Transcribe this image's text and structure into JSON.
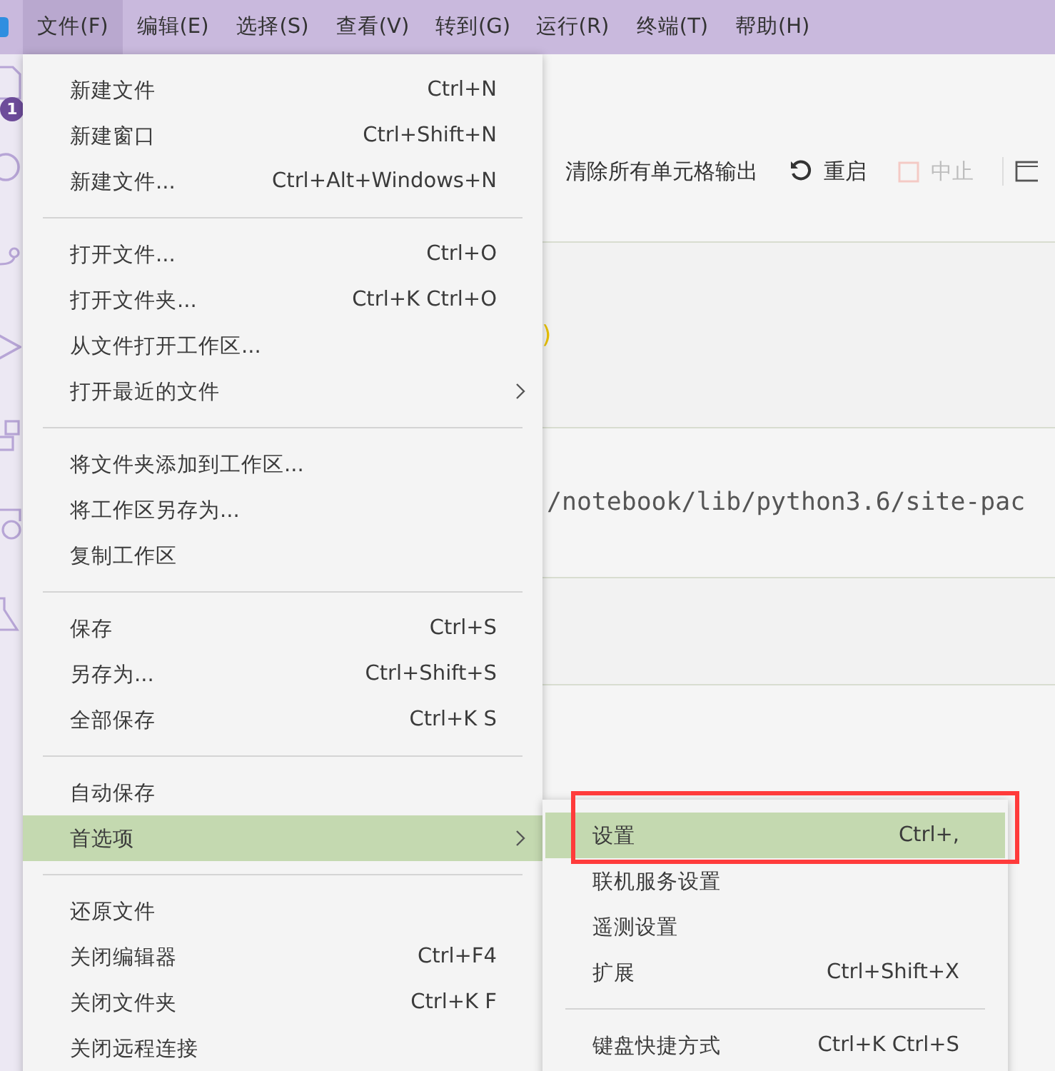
{
  "menubar": {
    "items": [
      {
        "label": "文件(F)",
        "selected": true
      },
      {
        "label": "编辑(E)",
        "selected": false
      },
      {
        "label": "选择(S)",
        "selected": false
      },
      {
        "label": "查看(V)",
        "selected": false
      },
      {
        "label": "转到(G)",
        "selected": false
      },
      {
        "label": "运行(R)",
        "selected": false
      },
      {
        "label": "终端(T)",
        "selected": false
      },
      {
        "label": "帮助(H)",
        "selected": false
      }
    ]
  },
  "activity_bar": {
    "badge": "1"
  },
  "toolbar": {
    "items": [
      {
        "kind": "clear",
        "label": "清除所有单元格输出",
        "disabled": false
      },
      {
        "kind": "restart",
        "label": "重启",
        "disabled": false
      },
      {
        "kind": "stop",
        "label": "中止",
        "disabled": true
      },
      {
        "kind": "variables"
      }
    ]
  },
  "editor": {
    "code_fragment": ")",
    "output_text": "/notebook/lib/python3.6/site-pac"
  },
  "file_menu": {
    "groups": [
      [
        {
          "label": "新建文件",
          "shortcut": "Ctrl+N",
          "submenu": false,
          "selected": false
        },
        {
          "label": "新建窗口",
          "shortcut": "Ctrl+Shift+N",
          "submenu": false,
          "selected": false
        },
        {
          "label": "新建文件...",
          "shortcut": "Ctrl+Alt+Windows+N",
          "submenu": false,
          "selected": false
        }
      ],
      [
        {
          "label": "打开文件...",
          "shortcut": "Ctrl+O",
          "submenu": false,
          "selected": false
        },
        {
          "label": "打开文件夹...",
          "shortcut": "Ctrl+K Ctrl+O",
          "submenu": false,
          "selected": false
        },
        {
          "label": "从文件打开工作区...",
          "submenu": false,
          "selected": false
        },
        {
          "label": "打开最近的文件",
          "submenu": true,
          "selected": false
        }
      ],
      [
        {
          "label": "将文件夹添加到工作区...",
          "submenu": false,
          "selected": false
        },
        {
          "label": "将工作区另存为...",
          "submenu": false,
          "selected": false
        },
        {
          "label": "复制工作区",
          "submenu": false,
          "selected": false
        }
      ],
      [
        {
          "label": "保存",
          "shortcut": "Ctrl+S",
          "submenu": false,
          "selected": false
        },
        {
          "label": "另存为...",
          "shortcut": "Ctrl+Shift+S",
          "submenu": false,
          "selected": false
        },
        {
          "label": "全部保存",
          "shortcut": "Ctrl+K S",
          "submenu": false,
          "selected": false
        }
      ],
      [
        {
          "label": "自动保存",
          "submenu": false,
          "selected": false
        },
        {
          "label": "首选项",
          "submenu": true,
          "selected": true
        }
      ],
      [
        {
          "label": "还原文件",
          "submenu": false,
          "selected": false
        },
        {
          "label": "关闭编辑器",
          "shortcut": "Ctrl+F4",
          "submenu": false,
          "selected": false
        },
        {
          "label": "关闭文件夹",
          "shortcut": "Ctrl+K F",
          "submenu": false,
          "selected": false
        },
        {
          "label": "关闭远程连接",
          "submenu": false,
          "selected": false
        }
      ]
    ]
  },
  "preferences_submenu": {
    "highlight_frame": true,
    "groups": [
      [
        {
          "label": "设置",
          "shortcut": "Ctrl+,",
          "submenu": false,
          "selected": true
        },
        {
          "label": "联机服务设置",
          "submenu": false,
          "selected": false
        },
        {
          "label": "遥测设置",
          "submenu": false,
          "selected": false
        },
        {
          "label": "扩展",
          "shortcut": "Ctrl+Shift+X",
          "submenu": false,
          "selected": false
        }
      ],
      [
        {
          "label": "键盘快捷方式",
          "shortcut": "Ctrl+K Ctrl+S",
          "submenu": false,
          "selected": false
        }
      ]
    ]
  }
}
